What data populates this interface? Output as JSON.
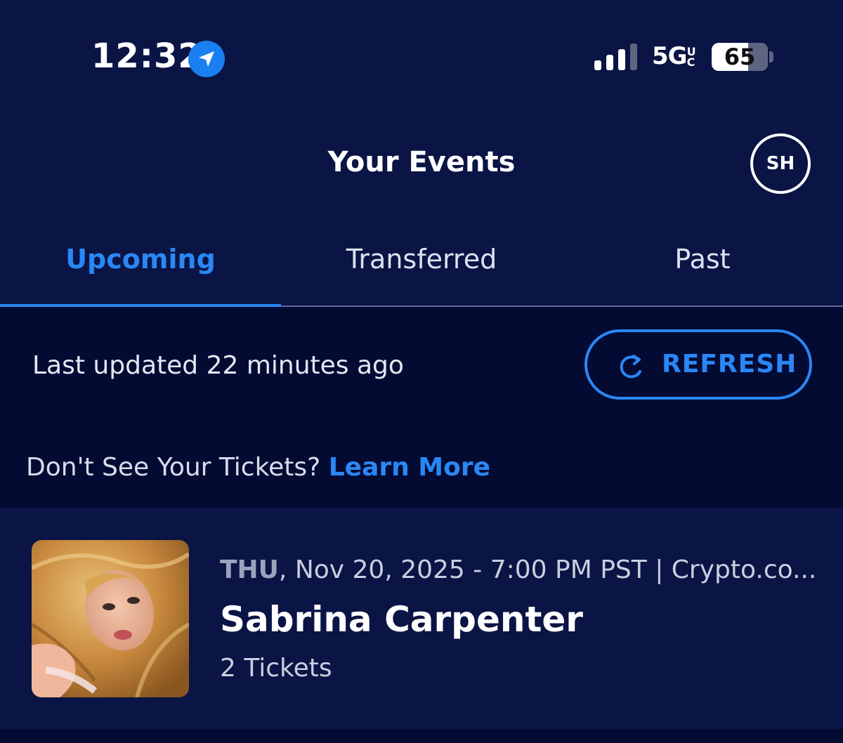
{
  "status_bar": {
    "time": "12:32",
    "network": "5G",
    "network_suffix": "UC",
    "battery_level": "65"
  },
  "header": {
    "title": "Your Events",
    "avatar_initials": "SH"
  },
  "tabs": [
    {
      "label": "Upcoming",
      "active": true
    },
    {
      "label": "Transferred",
      "active": false
    },
    {
      "label": "Past",
      "active": false
    }
  ],
  "info": {
    "last_updated": "Last updated 22 minutes ago",
    "refresh_label": "REFRESH",
    "help_prompt": "Don't See Your Tickets?",
    "learn_more": "Learn More"
  },
  "events": [
    {
      "day": "THU",
      "details": "Nov 20, 2025 - 7:00 PM PST | Crypto.co...",
      "title": "Sabrina Carpenter",
      "tickets": "2 Tickets"
    }
  ],
  "colors": {
    "background": "#0a1445",
    "band": "#030b33",
    "accent": "#2a87f5"
  }
}
